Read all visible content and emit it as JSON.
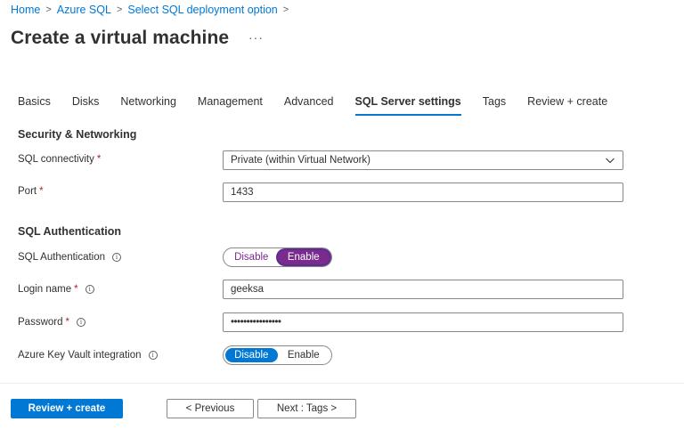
{
  "breadcrumb": [
    {
      "label": "Home"
    },
    {
      "label": "Azure SQL"
    },
    {
      "label": "Select SQL deployment option"
    }
  ],
  "header": {
    "title": "Create a virtual machine",
    "more_label": "···"
  },
  "tabs": [
    {
      "label": "Basics"
    },
    {
      "label": "Disks"
    },
    {
      "label": "Networking"
    },
    {
      "label": "Management"
    },
    {
      "label": "Advanced"
    },
    {
      "label": "SQL Server settings",
      "active": true
    },
    {
      "label": "Tags"
    },
    {
      "label": "Review + create"
    }
  ],
  "security": {
    "heading": "Security & Networking",
    "connectivity_label": "SQL connectivity",
    "connectivity_value": "Private (within Virtual Network)",
    "port_label": "Port",
    "port_value": "1433"
  },
  "auth": {
    "heading": "SQL Authentication",
    "sql_auth_label": "SQL Authentication",
    "sql_auth_toggle": {
      "off": "Disable",
      "on": "Enable",
      "selected": "Enable"
    },
    "login_label": "Login name",
    "login_value": "geeksa",
    "password_label": "Password",
    "password_value": "••••••••••••••••",
    "keyvault_label": "Azure Key Vault integration",
    "keyvault_toggle": {
      "off": "Disable",
      "on": "Enable",
      "selected": "Disable"
    }
  },
  "footer": {
    "review_label": "Review + create",
    "previous_label": "< Previous",
    "next_label": "Next : Tags >"
  },
  "colors": {
    "accent": "#0078d4",
    "sql_auth_accent": "#7b2a8e",
    "required": "#a4262c"
  }
}
